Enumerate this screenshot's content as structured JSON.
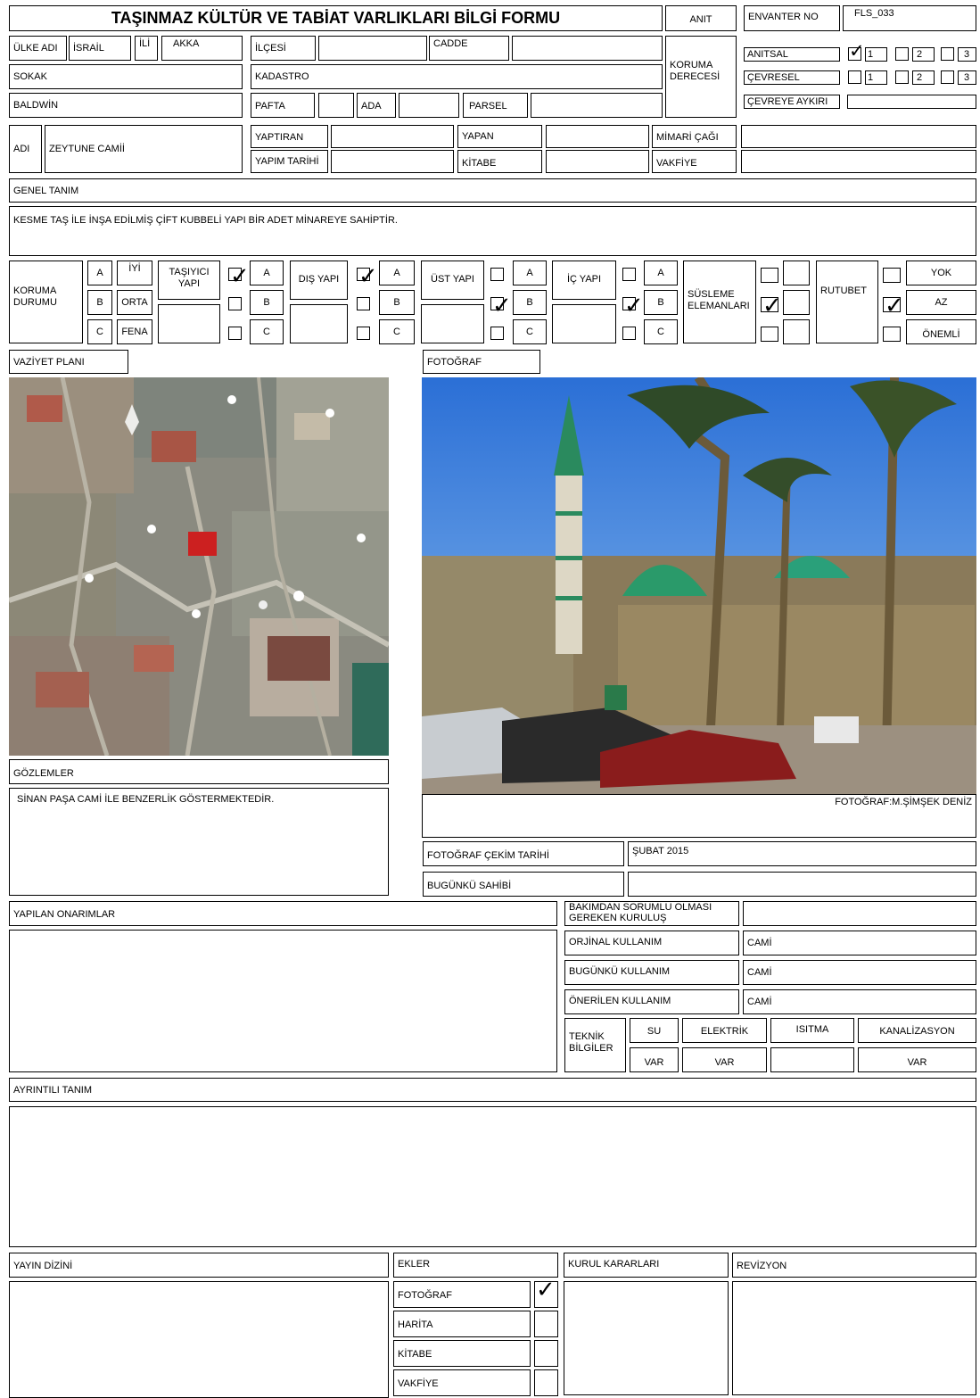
{
  "header": {
    "title": "TAŞINMAZ KÜLTÜR VE TABİAT VARLIKLARI BİLGİ FORMU",
    "anit": "ANIT",
    "envanter_no_label": "ENVANTER NO",
    "envanter_no": "FLS_033"
  },
  "location": {
    "ulke_label": "ÜLKE ADI",
    "ulke": "İSRAİL",
    "il_label": "İLİ",
    "il": "AKKA",
    "ilce_label": "İLÇESİ",
    "ilce": "",
    "cadde_label": "CADDE",
    "cadde": "",
    "sokak_label": "SOKAK",
    "sokak": "BALDWİN",
    "kadastro_label": "KADASTRO",
    "pafta_label": "PAFTA",
    "ada_label": "ADA",
    "parsel_label": "PARSEL"
  },
  "koruma_derecesi": {
    "label_line1": "KORUMA",
    "label_line2": "DERECESİ",
    "anitsal_label": "ANITSAL",
    "cevresel_label": "ÇEVRESEL",
    "cevreye_aykiri_label": "ÇEVREYE AYKIRI",
    "options": [
      "1",
      "2",
      "3"
    ],
    "anitsal_checked": [
      true,
      false,
      false
    ],
    "cevresel_checked": [
      false,
      false,
      false
    ]
  },
  "identity": {
    "adi_label": "ADI",
    "adi": "ZEYTUNE CAMİİ",
    "yaptiran_label": "YAPTIRAN",
    "yapim_tarihi_label": "YAPIM TARİHİ",
    "yapan_label": "YAPAN",
    "kitabe_label": "KİTABE",
    "mimari_cagi_label": "MİMARİ ÇAĞI",
    "vakfiye_label": "VAKFİYE"
  },
  "genel_tanim": {
    "label": "GENEL TANIM",
    "text": "KESME TAŞ İLE İNŞA EDİLMİŞ ÇİFT KUBBELİ YAPI BİR ADET MİNAREYE SAHİPTİR."
  },
  "koruma_durumu": {
    "label_line1": "KORUMA",
    "label_line2": "DURUMU",
    "grades": [
      "A",
      "B",
      "C"
    ],
    "grade_words": [
      "İYİ",
      "ORTA",
      "FENA"
    ],
    "tasiyici_label_line1": "TAŞIYICI",
    "tasiyici_label_line2": "YAPI",
    "dis_yapi_label": "DIŞ YAPI",
    "ust_yapi_label": "ÜST YAPI",
    "ic_yapi_label": "İÇ YAPI",
    "susleme_label_line1": "SÜSLEME",
    "susleme_label_line2": "ELEMANLARI",
    "rutubet_label": "RUTUBET",
    "rutubet_options": [
      "YOK",
      "AZ",
      "ÖNEMLİ"
    ],
    "tasiyici_checked": [
      true,
      false,
      false
    ],
    "dis_checked": [
      true,
      false,
      false
    ],
    "ust_checked": [
      false,
      true,
      false
    ],
    "ic_checked": [
      false,
      true,
      false
    ],
    "susleme_checked": [
      false,
      true,
      false
    ],
    "rutubet_checked": [
      false,
      true,
      false
    ]
  },
  "vaziyet_plani_label": "VAZİYET PLANI",
  "fotograf_label": "FOTOĞRAF",
  "photo_credit": "FOTOĞRAF:M.ŞİMŞEK DENİZ",
  "gozlemler": {
    "label": "GÖZLEMLER",
    "text": "SİNAN PAŞA CAMİ İLE BENZERLİK GÖSTERMEKTEDİR."
  },
  "fotograf_cekim_tarihi_label": "FOTOĞRAF ÇEKİM TARİHİ",
  "fotograf_cekim_tarihi": "ŞUBAT 2015",
  "bugunku_sahibi_label": "BUGÜNKÜ SAHİBİ",
  "yapilan_onarimlar_label": "YAPILAN ONARIMLAR",
  "usage": {
    "bakim_label_line1": "BAKIMDAN SORUMLU OLMASI",
    "bakim_label_line2": "GEREKEN KURULUŞ",
    "orjinal_label": "ORJİNAL KULLANIM",
    "orjinal": "CAMİ",
    "bugunku_label": "BUGÜNKÜ KULLANIM",
    "bugunku": "CAMİ",
    "onerilen_label": "ÖNERİLEN KULLANIM",
    "onerilen": "CAMİ"
  },
  "teknik": {
    "label_line1": "TEKNİK",
    "label_line2": "BİLGİLER",
    "su_label": "SU",
    "su": "VAR",
    "elektrik_label": "ELEKTRİK",
    "elektrik": "VAR",
    "isitma_label": "ISITMA",
    "isitma": "",
    "kanalizasyon_label": "KANALİZASYON",
    "kanalizasyon": "VAR"
  },
  "ayrintili_tanim_label": "AYRINTILI TANIM",
  "footer": {
    "yayin_dizini_label": "YAYIN DİZİNİ",
    "ekler_label": "EKLER",
    "kurul_kararlari_label": "KURUL KARARLARI",
    "revizyon_label": "REVİZYON",
    "ekler": [
      "FOTOĞRAF",
      "HARİTA",
      "KİTABE",
      "VAKFİYE"
    ],
    "ekler_checked": [
      true,
      false,
      false,
      false
    ]
  }
}
